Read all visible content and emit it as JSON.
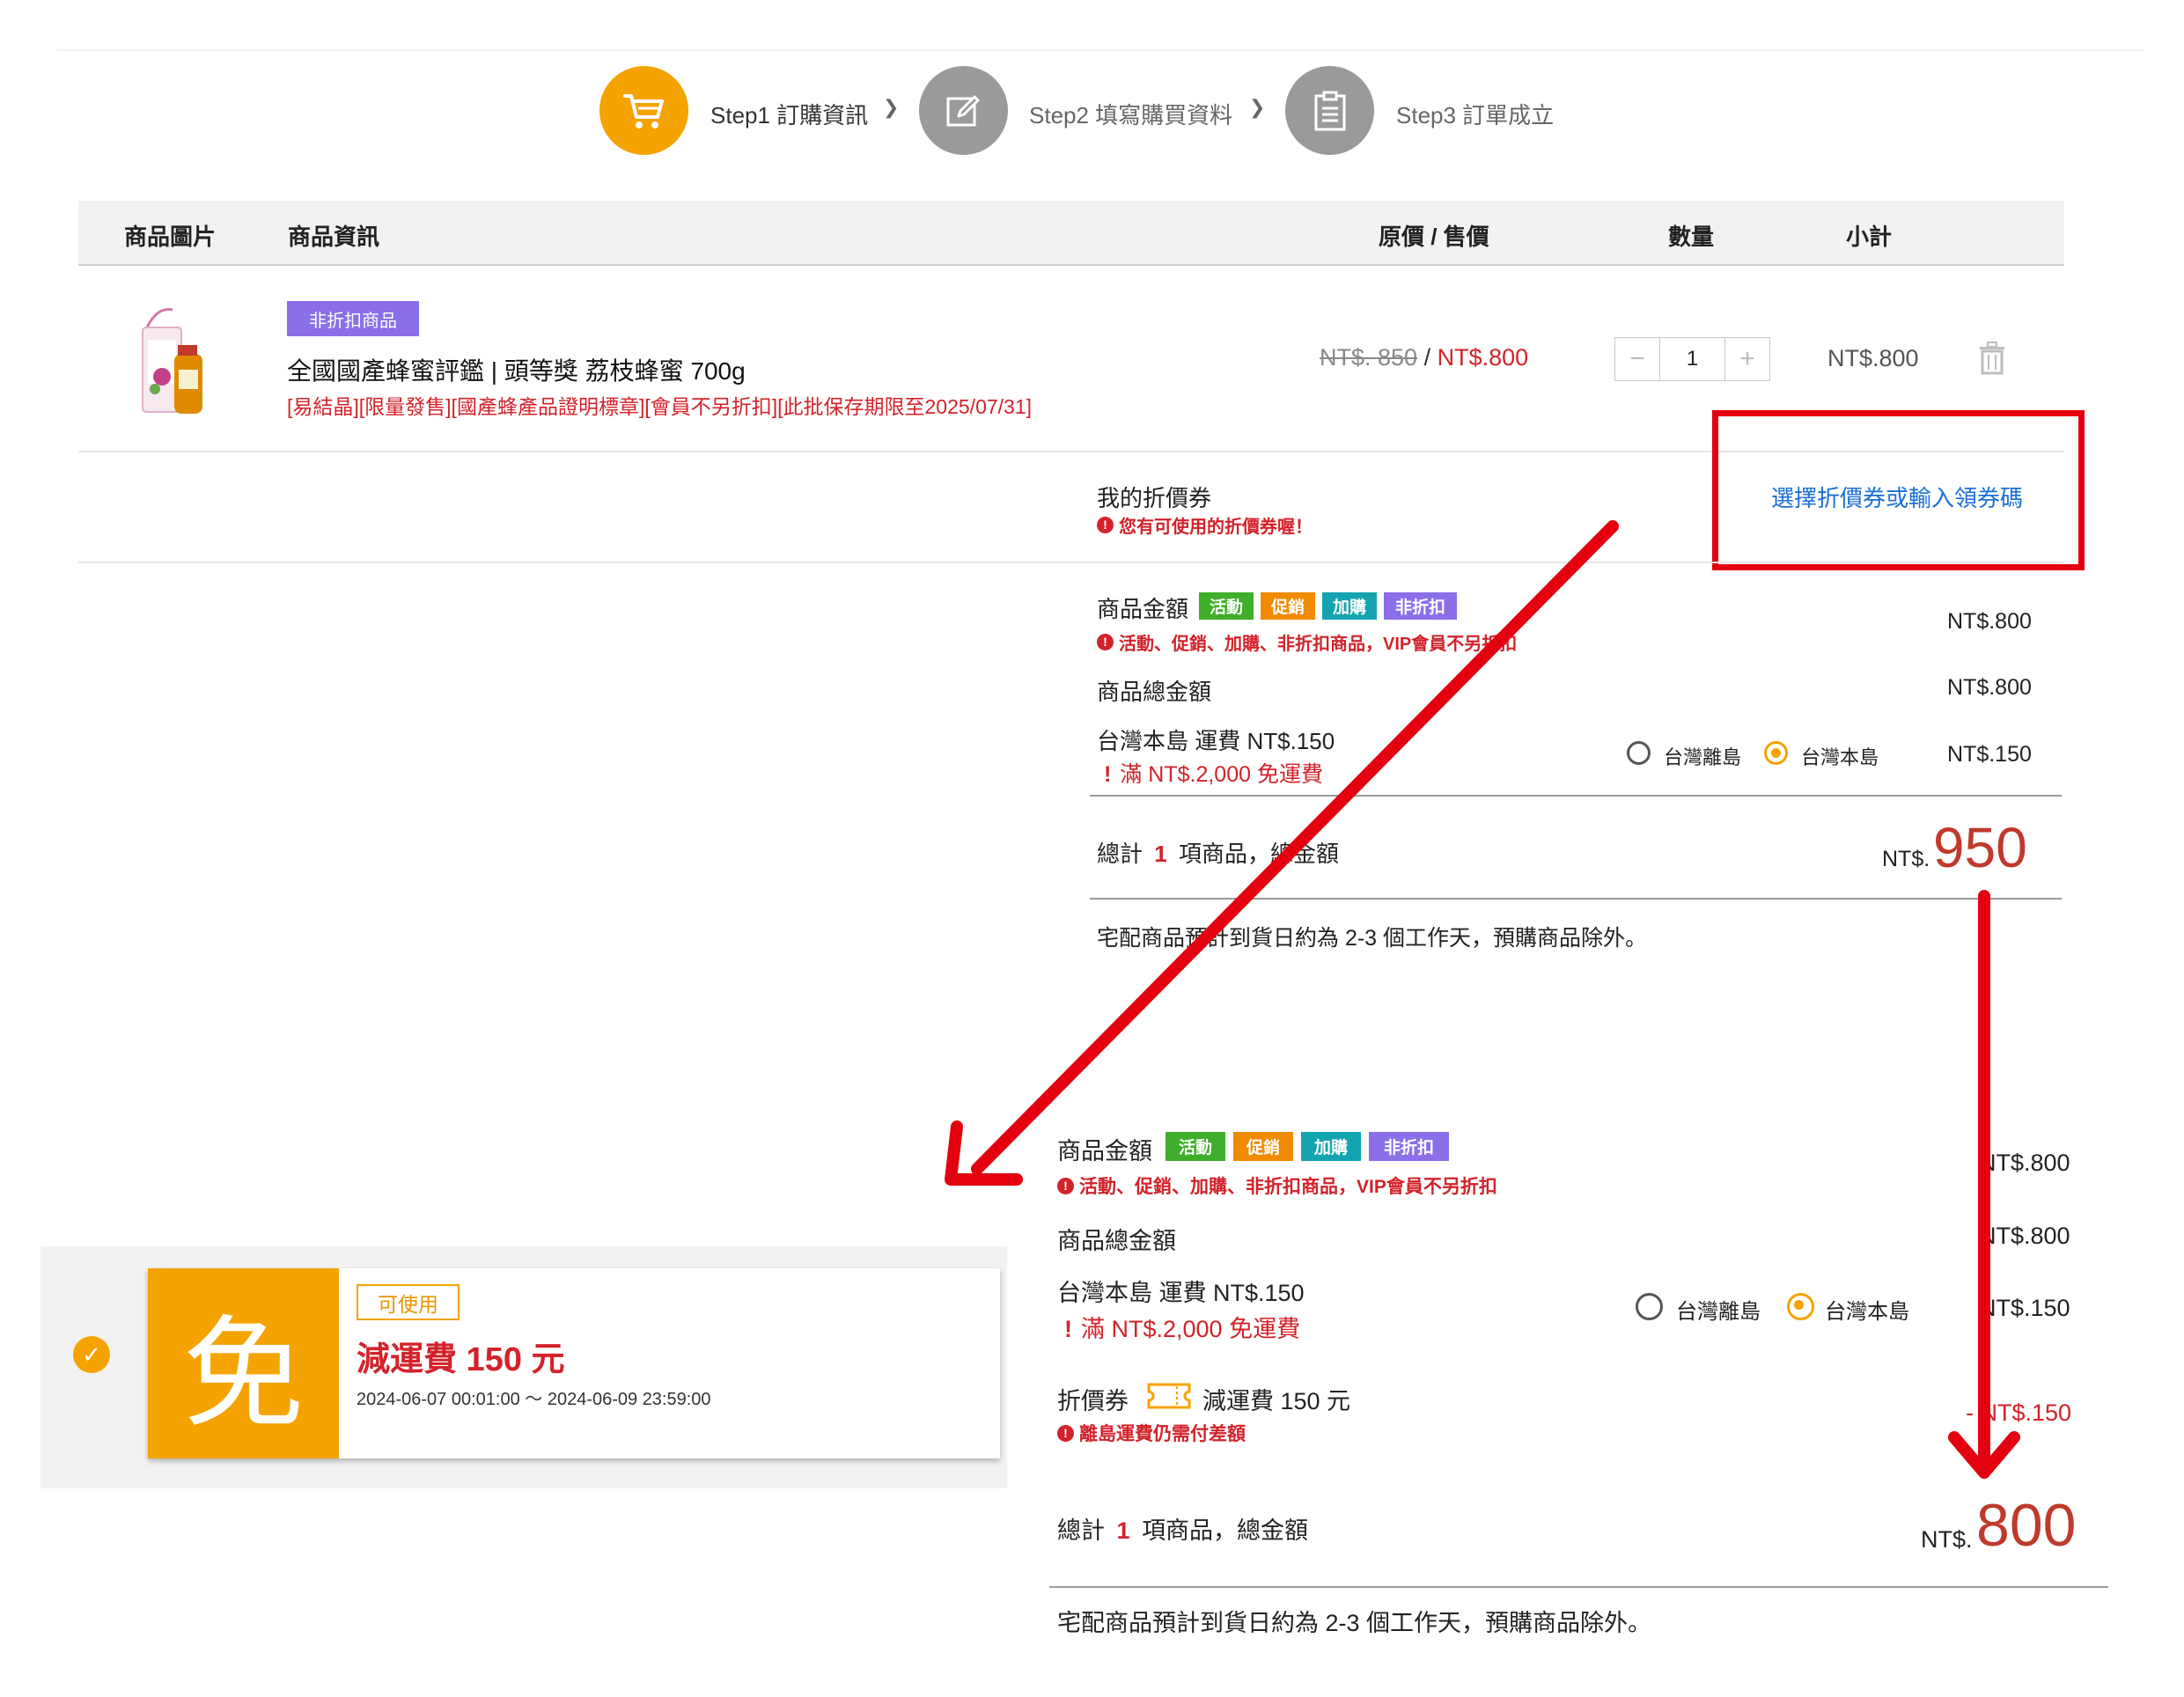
{
  "steps": [
    {
      "label": "Step1 訂購資訊",
      "icon": "cart-icon",
      "active": true
    },
    {
      "label": "Step2 填寫購買資料",
      "icon": "edit-icon",
      "active": false
    },
    {
      "label": "Step3 訂單成立",
      "icon": "clipboard-icon",
      "active": false
    }
  ],
  "table_header": {
    "image": "商品圖片",
    "info": "商品資訊",
    "price": "原價 / 售價",
    "qty": "數量",
    "subtotal": "小計"
  },
  "product": {
    "badge": "非折扣商品",
    "name": "全國國產蜂蜜評鑑 | 頭等獎 荔枝蜂蜜 700g",
    "notes": "[易結晶][限量發售][國產蜂產品證明標章][會員不另折扣][此批保存期限至2025/07/31]",
    "original_price": "NT$. 850",
    "separator": "/",
    "sale_price": "NT$.800",
    "quantity": "1",
    "minus": "−",
    "plus": "+",
    "subtotal": "NT$.800"
  },
  "coupon_row": {
    "label": "我的折價券",
    "notice": "您有可使用的折價券喔！",
    "link": "選擇折價券或輸入領券碼"
  },
  "tags": [
    {
      "text": "活動",
      "color": "#3fae2a"
    },
    {
      "text": "促銷",
      "color": "#f08a00"
    },
    {
      "text": "加購",
      "color": "#14a4b0"
    },
    {
      "text": "非折扣",
      "color": "#8a6fe8"
    }
  ],
  "colors": {
    "accent": "#f5a300",
    "price_red": "#d3222a",
    "link_blue": "#1a6fd6",
    "badge_purple": "#8a6fe8",
    "annotation_red": "#e3000f"
  },
  "summary_before": {
    "goods_label": "商品金額",
    "goods_note": "活動、促銷、加購、非折扣商品，VIP會員不另折扣",
    "goods_value": "NT$.800",
    "total_goods_label": "商品總金額",
    "total_goods_value": "NT$.800",
    "shipping_label": "台灣本島 運費 NT$.150",
    "shipping_note": "滿 NT$.2,000 免運費",
    "option_outer": "台灣離島",
    "option_main": "台灣本島",
    "shipping_value": "NT$.150",
    "total_prefix": "總計",
    "total_count": "1",
    "total_suffix": "項商品，總金額",
    "currency": "NT$.",
    "total_value": "950",
    "delivery_note": "宅配商品預計到貨日約為 2-3 個工作天，預購商品除外。"
  },
  "summary_after": {
    "goods_label": "商品金額",
    "goods_note": "活動、促銷、加購、非折扣商品，VIP會員不另折扣",
    "goods_value": "NT$.800",
    "total_goods_label": "商品總金額",
    "total_goods_value": "NT$.800",
    "shipping_label": "台灣本島 運費 NT$.150",
    "shipping_note": "滿 NT$.2,000 免運費",
    "option_outer": "台灣離島",
    "option_main": "台灣本島",
    "shipping_value": "NT$.150",
    "coupon_label": "折價券",
    "coupon_desc": "減運費 150 元",
    "coupon_note": "離島運費仍需付差額",
    "coupon_value": "- NT$.150",
    "total_prefix": "總計",
    "total_count": "1",
    "total_suffix": "項商品，總金額",
    "currency": "NT$.",
    "total_value": "800",
    "delivery_note": "宅配商品預計到貨日約為 2-3 個工作天，預購商品除外。"
  },
  "coupon_card": {
    "big_char": "免",
    "status": "可使用",
    "title": "減運費 150 元",
    "period": "2024-06-07 00:01:00 ～ 2024-06-09 23:59:00"
  }
}
